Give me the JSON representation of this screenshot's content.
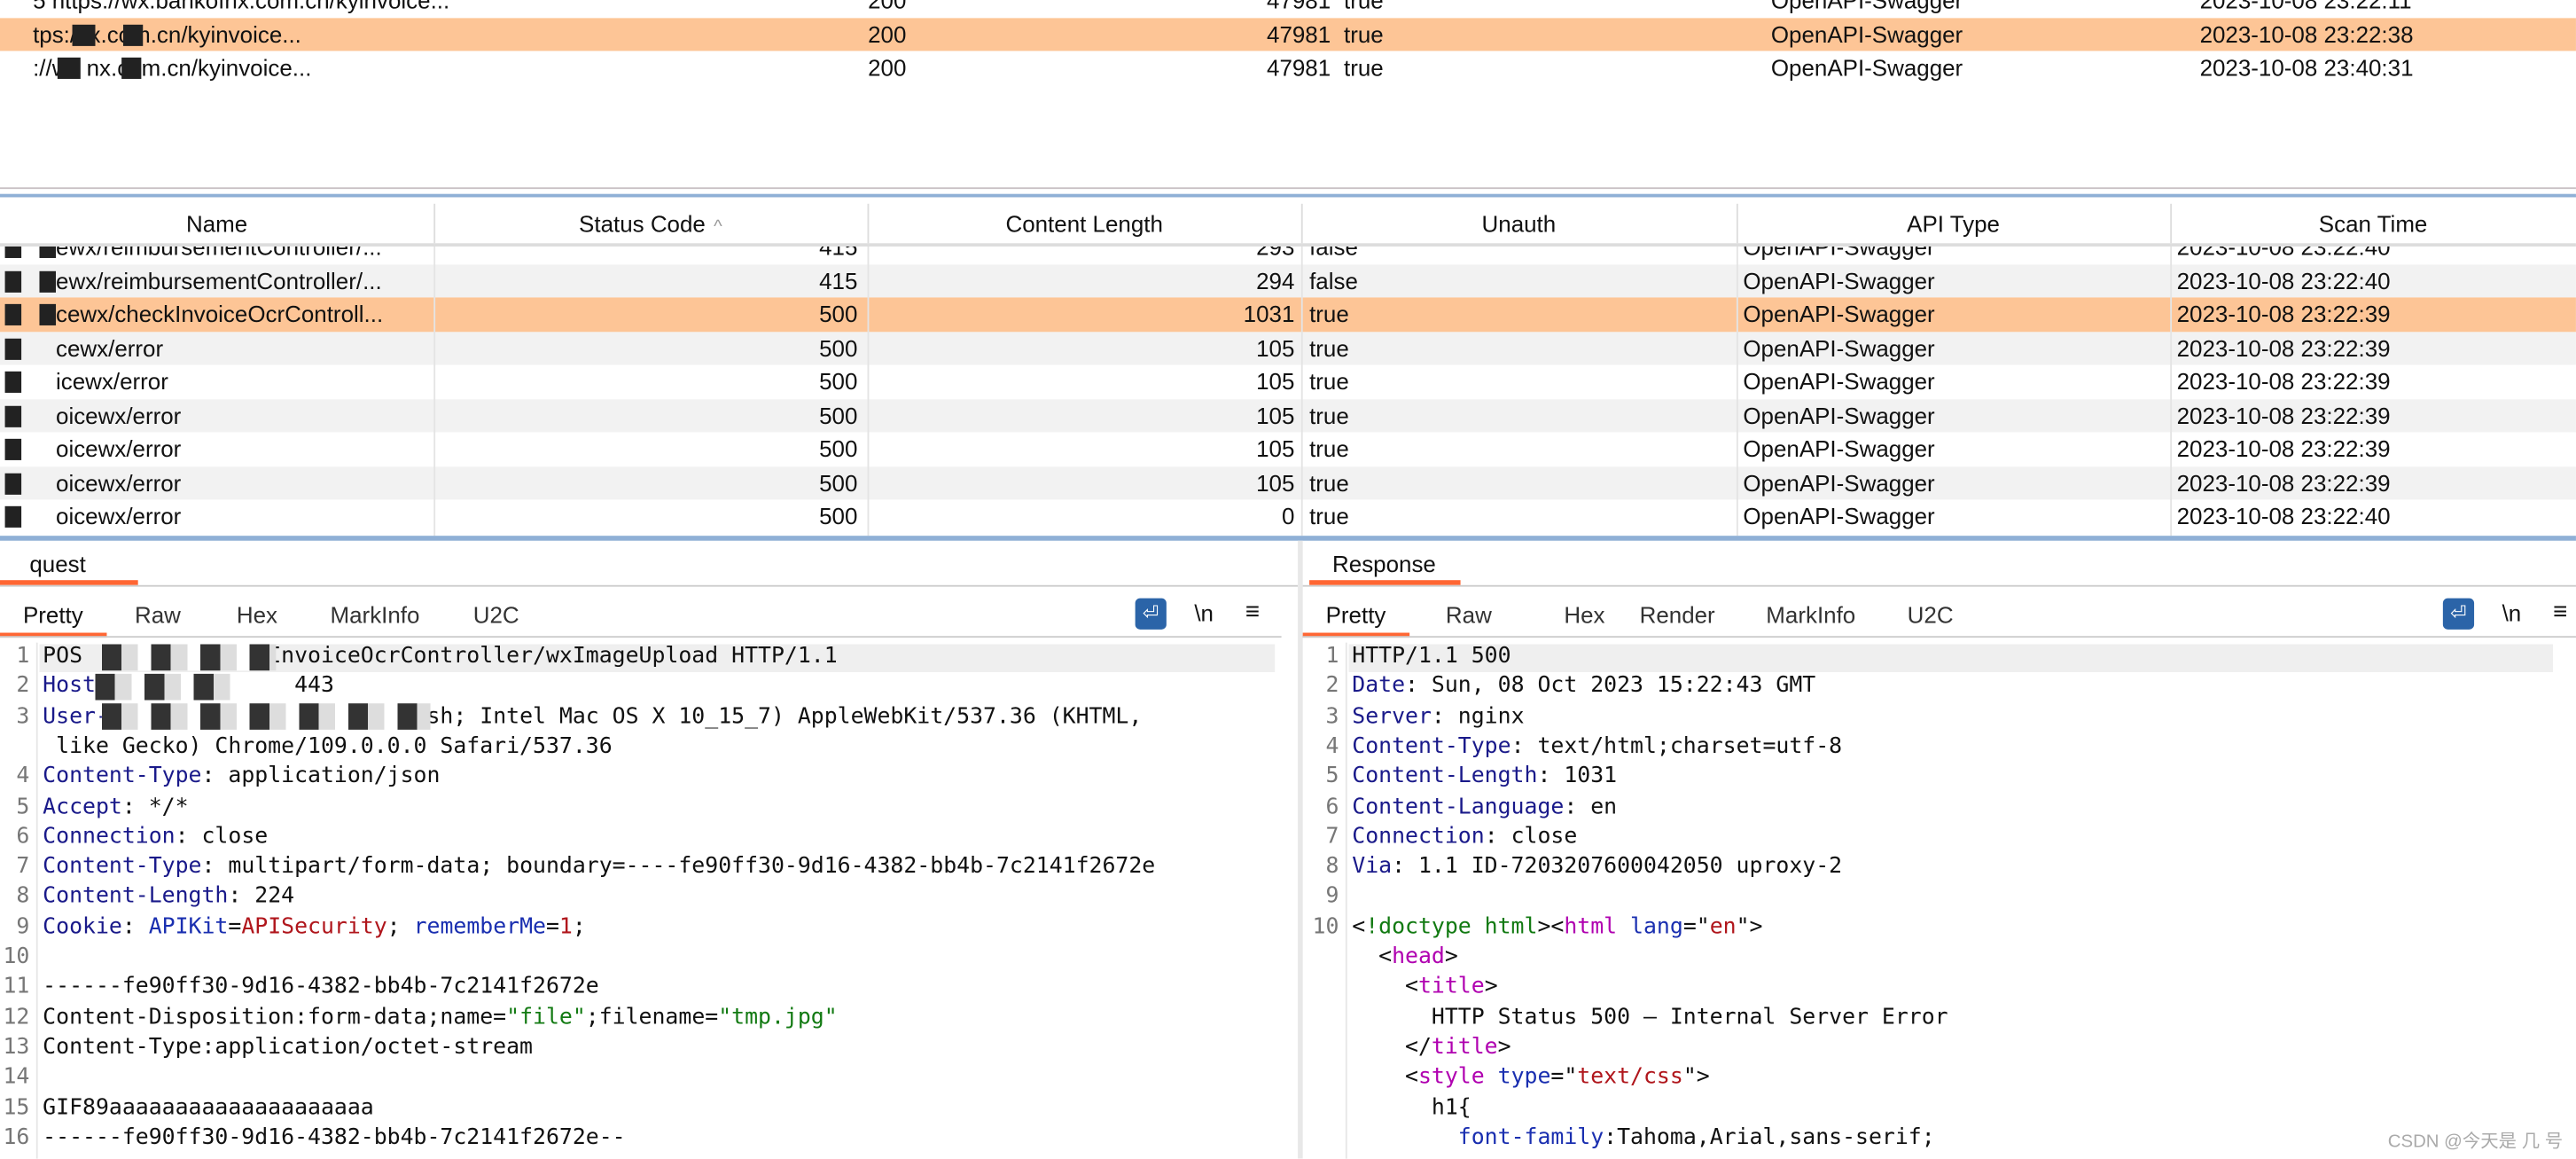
{
  "top_table": {
    "rows": [
      {
        "name": "5 https://wx.bankofnx.com.cn/kyinvoice...",
        "status": "200",
        "length": "47981",
        "unauth": "true",
        "api_type": "OpenAPI-Swagger",
        "scan_time": "2023-10-08 23:22:11",
        "selected": false
      },
      {
        "name": "tps://      x.com.cn/kyinvoice...",
        "status": "200",
        "length": "47981",
        "unauth": "true",
        "api_type": "OpenAPI-Swagger",
        "scan_time": "2023-10-08 23:22:38",
        "selected": true
      },
      {
        "name": "://wx      nx.com.cn/kyinvoice...",
        "status": "200",
        "length": "47981",
        "unauth": "true",
        "api_type": "OpenAPI-Swagger",
        "scan_time": "2023-10-08 23:40:31",
        "selected": false
      }
    ]
  },
  "bottom_table": {
    "columns": [
      "Name",
      "Status Code",
      "Content Length",
      "Unauth",
      "API Type",
      "Scan Time"
    ],
    "sort_indicator": "^",
    "rows": [
      {
        "name": "ewx/reimbursementController/...",
        "status": "415",
        "length": "293",
        "unauth": "false",
        "api_type": "OpenAPI-Swagger",
        "scan_time": "2023-10-08 23:22:40",
        "selected": false
      },
      {
        "name": "ewx/reimbursementController/...",
        "status": "415",
        "length": "294",
        "unauth": "false",
        "api_type": "OpenAPI-Swagger",
        "scan_time": "2023-10-08 23:22:40",
        "selected": false
      },
      {
        "name": "cewx/checkInvoiceOcrControll...",
        "status": "500",
        "length": "1031",
        "unauth": "true",
        "api_type": "OpenAPI-Swagger",
        "scan_time": "2023-10-08 23:22:39",
        "selected": true
      },
      {
        "name": "cewx/error",
        "status": "500",
        "length": "105",
        "unauth": "true",
        "api_type": "OpenAPI-Swagger",
        "scan_time": "2023-10-08 23:22:39",
        "selected": false
      },
      {
        "name": "icewx/error",
        "status": "500",
        "length": "105",
        "unauth": "true",
        "api_type": "OpenAPI-Swagger",
        "scan_time": "2023-10-08 23:22:39",
        "selected": false
      },
      {
        "name": "oicewx/error",
        "status": "500",
        "length": "105",
        "unauth": "true",
        "api_type": "OpenAPI-Swagger",
        "scan_time": "2023-10-08 23:22:39",
        "selected": false
      },
      {
        "name": "oicewx/error",
        "status": "500",
        "length": "105",
        "unauth": "true",
        "api_type": "OpenAPI-Swagger",
        "scan_time": "2023-10-08 23:22:39",
        "selected": false
      },
      {
        "name": "oicewx/error",
        "status": "500",
        "length": "105",
        "unauth": "true",
        "api_type": "OpenAPI-Swagger",
        "scan_time": "2023-10-08 23:22:39",
        "selected": false
      },
      {
        "name": "oicewx/error",
        "status": "500",
        "length": "0",
        "unauth": "true",
        "api_type": "OpenAPI-Swagger",
        "scan_time": "2023-10-08 23:22:40",
        "selected": false
      }
    ]
  },
  "request": {
    "tab": "quest",
    "subtabs": [
      "Pretty",
      "Raw",
      "Hex",
      "MarkInfo",
      "U2C"
    ],
    "active_subtab": "Pretty",
    "newline_label": "\\n",
    "lines": [
      {
        "n": "1",
        "segs": [
          [
            "POS",
            "d"
          ],
          [
            "        ",
            "d"
          ],
          [
            "/checkInvoiceOcrController/wxImageUpload HTTP/1.1",
            "d"
          ]
        ]
      },
      {
        "n": "2",
        "segs": [
          [
            "Host",
            "k"
          ],
          [
            "               443",
            "d"
          ]
        ]
      },
      {
        "n": "3",
        "segs": [
          [
            "User-agent",
            "k"
          ],
          [
            ":              intosh; Intel Mac OS X 10_15_7) AppleWebKit/537.36 (KHTML,",
            "d"
          ]
        ]
      },
      {
        "n": "",
        "segs": [
          [
            " like Gecko) Chrome/109.0.0.0 Safari/537.36",
            "d"
          ]
        ]
      },
      {
        "n": "4",
        "segs": [
          [
            "Content-Type",
            "k"
          ],
          [
            ": application/json",
            "d"
          ]
        ]
      },
      {
        "n": "5",
        "segs": [
          [
            "Accept",
            "k"
          ],
          [
            ": */*",
            "d"
          ]
        ]
      },
      {
        "n": "6",
        "segs": [
          [
            "Connection",
            "k"
          ],
          [
            ": close",
            "d"
          ]
        ]
      },
      {
        "n": "7",
        "segs": [
          [
            "Content-Type",
            "k"
          ],
          [
            ": multipart/form-data; boundary=----fe90ff30-9d16-4382-bb4b-7c2141f2672e",
            "d"
          ]
        ]
      },
      {
        "n": "8",
        "segs": [
          [
            "Content-Length",
            "k"
          ],
          [
            ": 224",
            "d"
          ]
        ]
      },
      {
        "n": "9",
        "segs": [
          [
            "Cookie",
            "k"
          ],
          [
            ": ",
            "d"
          ],
          [
            "APIKit",
            "b"
          ],
          [
            "=",
            "d"
          ],
          [
            "APISecurity",
            "r"
          ],
          [
            "; ",
            "d"
          ],
          [
            "rememberMe",
            "b"
          ],
          [
            "=",
            "d"
          ],
          [
            "1",
            "r"
          ],
          [
            ";",
            "d"
          ]
        ]
      },
      {
        "n": "10",
        "segs": []
      },
      {
        "n": "11",
        "segs": [
          [
            "------fe90ff30-9d16-4382-bb4b-7c2141f2672e",
            "d"
          ]
        ]
      },
      {
        "n": "12",
        "segs": [
          [
            "Content-Disposition:form-data;name=",
            "d"
          ],
          [
            "\"file\"",
            "g"
          ],
          [
            ";filename=",
            "d"
          ],
          [
            "\"tmp.jpg\"",
            "g"
          ]
        ]
      },
      {
        "n": "13",
        "segs": [
          [
            "Content-Type:application/octet-stream",
            "d"
          ]
        ]
      },
      {
        "n": "14",
        "segs": []
      },
      {
        "n": "15",
        "segs": [
          [
            "GIF89aaaaaaaaaaaaaaaaaaaa",
            "d"
          ]
        ]
      },
      {
        "n": "16",
        "segs": [
          [
            "------fe90ff30-9d16-4382-bb4b-7c2141f2672e--",
            "d"
          ]
        ]
      }
    ]
  },
  "response": {
    "tab": "Response",
    "subtabs": [
      "Pretty",
      "Raw",
      "Hex",
      "Render",
      "MarkInfo",
      "U2C"
    ],
    "active_subtab": "Pretty",
    "newline_label": "\\n",
    "lines": [
      {
        "n": "1",
        "segs": [
          [
            "HTTP/1.1 500",
            "d"
          ]
        ]
      },
      {
        "n": "2",
        "segs": [
          [
            "Date",
            "k"
          ],
          [
            ": Sun, 08 Oct 2023 15:22:43 GMT",
            "d"
          ]
        ]
      },
      {
        "n": "3",
        "segs": [
          [
            "Server",
            "k"
          ],
          [
            ": nginx",
            "d"
          ]
        ]
      },
      {
        "n": "4",
        "segs": [
          [
            "Content-Type",
            "k"
          ],
          [
            ": text/html;charset=utf-8",
            "d"
          ]
        ]
      },
      {
        "n": "5",
        "segs": [
          [
            "Content-Length",
            "k"
          ],
          [
            ": 1031",
            "d"
          ]
        ]
      },
      {
        "n": "6",
        "segs": [
          [
            "Content-Language",
            "k"
          ],
          [
            ": en",
            "d"
          ]
        ]
      },
      {
        "n": "7",
        "segs": [
          [
            "Connection",
            "k"
          ],
          [
            ": close",
            "d"
          ]
        ]
      },
      {
        "n": "8",
        "segs": [
          [
            "Via",
            "k"
          ],
          [
            ": 1.1 ID-7203207600042050 uproxy-2",
            "d"
          ]
        ]
      },
      {
        "n": "9",
        "segs": []
      },
      {
        "n": "10",
        "segs": [
          [
            "<",
            "d"
          ],
          [
            "!doctype html",
            "g"
          ],
          [
            "><",
            "d"
          ],
          [
            "html",
            "p"
          ],
          [
            " ",
            "d"
          ],
          [
            "lang",
            "b"
          ],
          [
            "=\"",
            "d"
          ],
          [
            "en",
            "r"
          ],
          [
            "\">",
            "d"
          ]
        ]
      },
      {
        "n": "",
        "segs": [
          [
            "  <",
            "d"
          ],
          [
            "head",
            "p"
          ],
          [
            ">",
            "d"
          ]
        ]
      },
      {
        "n": "",
        "segs": [
          [
            "    <",
            "d"
          ],
          [
            "title",
            "p"
          ],
          [
            ">",
            "d"
          ]
        ]
      },
      {
        "n": "",
        "segs": [
          [
            "      HTTP Status 500 – Internal Server Error",
            "d"
          ]
        ]
      },
      {
        "n": "",
        "segs": [
          [
            "    </",
            "d"
          ],
          [
            "title",
            "p"
          ],
          [
            ">",
            "d"
          ]
        ]
      },
      {
        "n": "",
        "segs": [
          [
            "    <",
            "d"
          ],
          [
            "style",
            "p"
          ],
          [
            " ",
            "d"
          ],
          [
            "type",
            "b"
          ],
          [
            "=\"",
            "d"
          ],
          [
            "text/css",
            "r"
          ],
          [
            "\">",
            "d"
          ]
        ]
      },
      {
        "n": "",
        "segs": [
          [
            "      h1{",
            "d"
          ]
        ]
      },
      {
        "n": "",
        "segs": [
          [
            "        ",
            "d"
          ],
          [
            "font-family",
            "b"
          ],
          [
            ":Tahoma,Arial,sans-serif;",
            "d"
          ]
        ]
      }
    ]
  },
  "watermark": "CSDN @今天是 几 号",
  "colors": {
    "selection": "#fdc596",
    "accent": "#ff6633",
    "wrap_button": "#2b64a8"
  }
}
